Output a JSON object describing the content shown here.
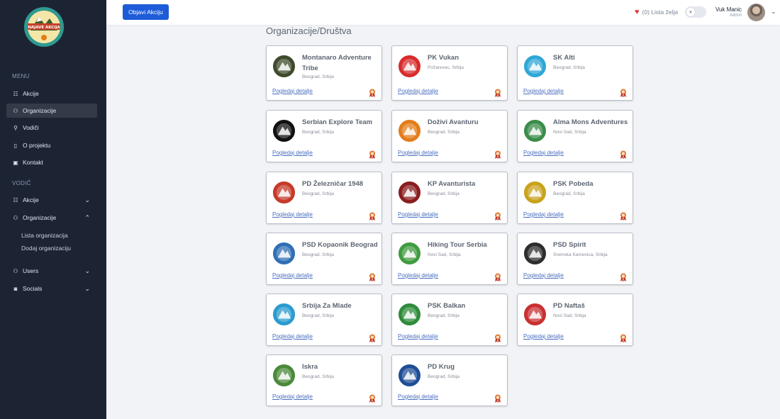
{
  "sidebar": {
    "logo_text": "NAJAVE AKCIJA",
    "menu_label": "MENU",
    "vodic_label": "VODIČ",
    "menu_items": [
      {
        "label": "Akcije"
      },
      {
        "label": "Organizacije"
      },
      {
        "label": "Vodiči"
      },
      {
        "label": "O projektu"
      },
      {
        "label": "Kontakt"
      }
    ],
    "vodic_items": [
      {
        "label": "Akcije"
      },
      {
        "label": "Organizacije"
      }
    ],
    "sub_items": [
      "Lista organizacija",
      "Dodaj organizaciju"
    ],
    "extra_items": [
      {
        "label": "Users"
      },
      {
        "label": "Socials"
      }
    ]
  },
  "header": {
    "button_label": "Objavi Akciju",
    "wishlist_label": "(0) Lista želja",
    "user_name": "Vuk Manic",
    "user_role": "Admin"
  },
  "page_title": "Organizacije/Društva",
  "detail_link_label": "Pogledaj detalje",
  "organizations": [
    {
      "name": "Montanaro Adventure Tribe",
      "location": "Beograd, Srbija",
      "color": "#3e4b2c"
    },
    {
      "name": "PK Vukan",
      "location": "Požarevac, Srbija",
      "color": "#d92b2b"
    },
    {
      "name": "SK Alti",
      "location": "Beograd, Srbija",
      "color": "#2fa7d6"
    },
    {
      "name": "Serbian Explore Team",
      "location": "Beograd, Srbija",
      "color": "#111111"
    },
    {
      "name": "Doživi Avanturu",
      "location": "Beograd, Srbija",
      "color": "#e37c1a"
    },
    {
      "name": "Alma Mons Adventures",
      "location": "Novi Sad, Srbija",
      "color": "#3a8d4a"
    },
    {
      "name": "PD Železničar 1948",
      "location": "Beograd, Srbija",
      "color": "#c53a2a"
    },
    {
      "name": "KP Avanturista",
      "location": "Beograd, Srbija",
      "color": "#8a1d1d"
    },
    {
      "name": "PSK Pobeda",
      "location": "Beograd, Srbija",
      "color": "#c9a21c"
    },
    {
      "name": "PSD Kopaonik Beograd",
      "location": "Beograd, Srbija",
      "color": "#2f6fb5"
    },
    {
      "name": "Hiking Tour Serbia",
      "location": "Novi Sad, Srbija",
      "color": "#3f9b3f"
    },
    {
      "name": "PSD Spirit",
      "location": "Sremska Kamenica, Srbija",
      "color": "#2d2d2d"
    },
    {
      "name": "Srbija Za Mlade",
      "location": "Beograd, Srbija",
      "color": "#2a9bd0"
    },
    {
      "name": "PSK Balkan",
      "location": "Beograd, Srbija",
      "color": "#2e8b3a"
    },
    {
      "name": "PD Naftaš",
      "location": "Novi Sad, Srbija",
      "color": "#c93030"
    },
    {
      "name": "Iskra",
      "location": "Beograd, Srbija",
      "color": "#4a8a3a"
    },
    {
      "name": "PD Krug",
      "location": "Beograd, Srbija",
      "color": "#1f4e96"
    }
  ]
}
